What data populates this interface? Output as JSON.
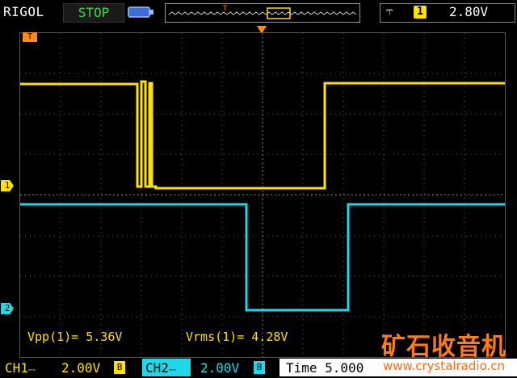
{
  "header": {
    "brand": "RIGOL",
    "run_state": "STOP",
    "trigger_edge_icon": "rising-edge-icon",
    "trigger_source": "1",
    "trigger_level": "2.80V"
  },
  "markers": {
    "trigger_time": "T",
    "trigger_level": "T",
    "ch1": "1",
    "ch2": "2"
  },
  "colors": {
    "ch1": "#ffe100",
    "ch2": "#20d8e8",
    "trigger": "#ff8c1a"
  },
  "measurements": {
    "vpp": "Vpp(1)= 5.36V",
    "vrms": "Vrms(1)= 4.28V"
  },
  "footer": {
    "ch1_label": "CH1",
    "ch1_scale": "2.00V",
    "ch1_badge": "B",
    "ch2_label": "CH2",
    "ch2_scale": "2.00V",
    "ch2_badge": "B",
    "time": "Time 5.000",
    "watermark_title": "矿石收音机",
    "watermark_url": "www.crystalradio.cn"
  }
}
